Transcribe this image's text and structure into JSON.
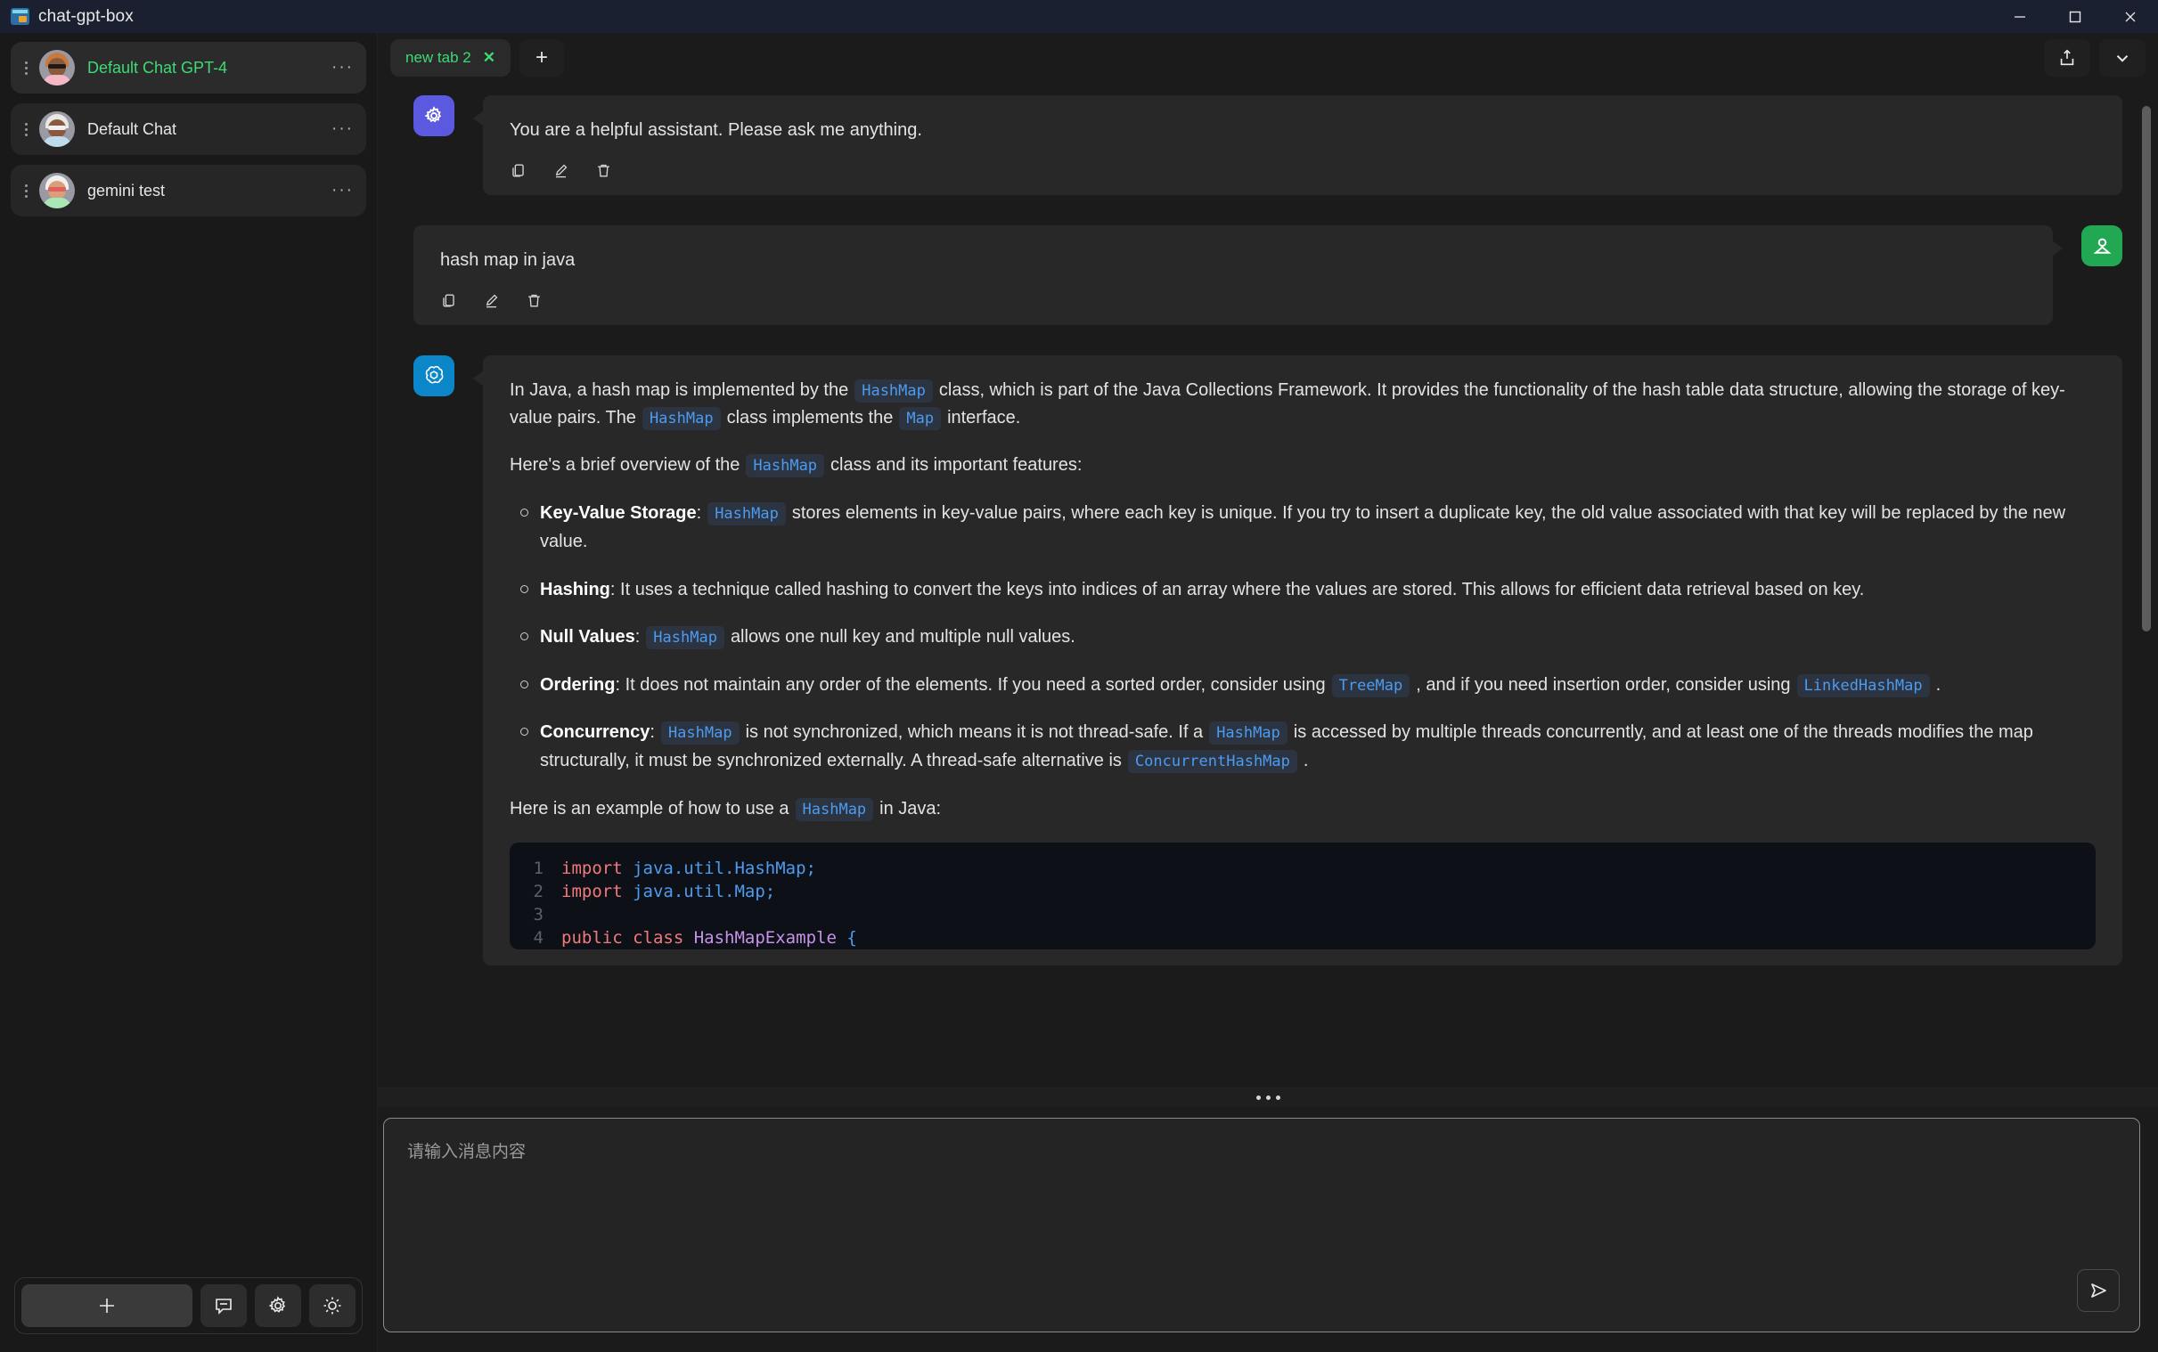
{
  "window": {
    "title": "chat-gpt-box",
    "icon": "app-window-icon",
    "controls": {
      "minimize": "minimize-icon",
      "maximize": "maximize-icon",
      "close": "close-icon"
    }
  },
  "sidebar": {
    "chats": [
      {
        "name": "Default Chat GPT-4",
        "active": true,
        "more": "···"
      },
      {
        "name": "Default Chat",
        "active": false,
        "more": "···"
      },
      {
        "name": "gemini test",
        "active": false,
        "more": "···"
      }
    ],
    "toolbar": {
      "add_label": "+",
      "buttons": [
        "chat-bubble-icon",
        "gear-icon",
        "sun-icon"
      ]
    }
  },
  "tabs": {
    "items": [
      {
        "label": "new tab 2",
        "close": "✕",
        "active": true
      }
    ],
    "add_label": "+",
    "right_buttons": [
      "share-icon",
      "chevron-down-icon"
    ]
  },
  "messages": [
    {
      "role": "system",
      "avatar": "gear-icon",
      "text": "You are a helpful assistant. Please ask me anything.",
      "actions": [
        "copy-icon",
        "edit-icon",
        "delete-icon"
      ]
    },
    {
      "role": "user",
      "avatar": "person-icon",
      "text": "hash map in java",
      "actions": [
        "copy-icon",
        "edit-icon",
        "delete-icon"
      ]
    }
  ],
  "assistant": {
    "avatar": "openai-logo-icon",
    "p1_a": "In Java, a hash map is implemented by the",
    "p1_code1": "HashMap",
    "p1_b": "class, which is part of the Java Collections Framework. It provides the functionality of the hash table data structure, allowing the storage of key-value pairs. The",
    "p1_code2": "HashMap",
    "p1_c": "class implements the",
    "p1_code3": "Map",
    "p1_d": "interface.",
    "p2_a": "Here's a brief overview of the",
    "p2_code": "HashMap",
    "p2_b": "class and its important features:",
    "features": [
      {
        "title": "Key-Value Storage",
        "a": ":",
        "code": "HashMap",
        "b": "stores elements in key-value pairs, where each key is unique. If you try to insert a duplicate key, the old value associated with that key will be replaced by the new value."
      },
      {
        "title": "Hashing",
        "a": ": It uses a technique called hashing to convert the keys into indices of an array where the values are stored. This allows for efficient data retrieval based on key.",
        "code": "",
        "b": ""
      },
      {
        "title": "Null Values",
        "a": ":",
        "code": "HashMap",
        "b": "allows one null key and multiple null values."
      },
      {
        "title": "Ordering",
        "a": ": It does not maintain any order of the elements. If you need a sorted order, consider using",
        "code": "TreeMap",
        "b": ", and if you need insertion order, consider using",
        "code2": "LinkedHashMap",
        "c": "."
      },
      {
        "title": "Concurrency",
        "a": ":",
        "code": "HashMap",
        "b": "is not synchronized, which means it is not thread-safe. If a",
        "code2": "HashMap",
        "c": "is accessed by multiple threads concurrently, and at least one of the threads modifies the map structurally, it must be synchronized externally. A thread-safe alternative is",
        "code3": "ConcurrentHashMap",
        "d": "."
      }
    ],
    "p3_a": "Here is an example of how to use a",
    "p3_code": "HashMap",
    "p3_b": "in Java:",
    "code_lines": [
      {
        "n": "1",
        "kw": "import",
        "pkg": " java.util.HashMap;",
        "cls": "",
        "punc": ""
      },
      {
        "n": "2",
        "kw": "import",
        "pkg": " java.util.Map;",
        "cls": "",
        "punc": ""
      },
      {
        "n": "3",
        "kw": "",
        "pkg": "",
        "cls": "",
        "punc": ""
      },
      {
        "n": "4",
        "kw": "public class",
        "pkg": " ",
        "cls": "HashMapExample",
        "punc": " {"
      }
    ]
  },
  "input": {
    "placeholder": "请输入消息内容",
    "value": "",
    "send_icon": "send-icon"
  }
}
